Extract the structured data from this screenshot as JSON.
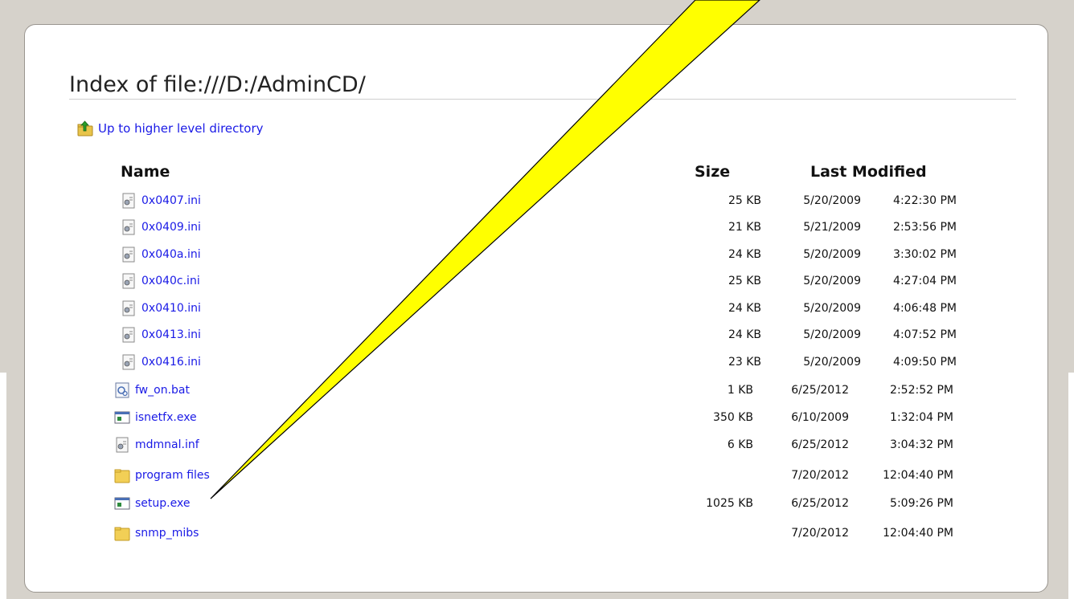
{
  "page": {
    "title": "Index of file:///D:/AdminCD/",
    "up_link": "Up to higher level directory"
  },
  "columns": {
    "name": "Name",
    "size": "Size",
    "modified": "Last Modified"
  },
  "files": [
    {
      "name": "0x0407.ini",
      "size": "25 KB",
      "date": "5/20/2009",
      "time": "4:22:30 PM",
      "icon": "ini-file-icon"
    },
    {
      "name": "0x0409.ini",
      "size": "21 KB",
      "date": "5/21/2009",
      "time": "2:53:56 PM",
      "icon": "ini-file-icon"
    },
    {
      "name": "0x040a.ini",
      "size": "24 KB",
      "date": "5/20/2009",
      "time": "3:30:02 PM",
      "icon": "ini-file-icon"
    },
    {
      "name": "0x040c.ini",
      "size": "25 KB",
      "date": "5/20/2009",
      "time": "4:27:04 PM",
      "icon": "ini-file-icon"
    },
    {
      "name": "0x0410.ini",
      "size": "24 KB",
      "date": "5/20/2009",
      "time": "4:06:48 PM",
      "icon": "ini-file-icon"
    },
    {
      "name": "0x0413.ini",
      "size": "24 KB",
      "date": "5/20/2009",
      "time": "4:07:52 PM",
      "icon": "ini-file-icon"
    },
    {
      "name": "0x0416.ini",
      "size": "23 KB",
      "date": "5/20/2009",
      "time": "4:09:50 PM",
      "icon": "ini-file-icon"
    },
    {
      "name": "fw_on.bat",
      "size": "1 KB",
      "date": "6/25/2012",
      "time": "2:52:52 PM",
      "icon": "batch-file-icon"
    },
    {
      "name": "isnetfx.exe",
      "size": "350 KB",
      "date": "6/10/2009",
      "time": "1:32:04 PM",
      "icon": "executable-icon"
    },
    {
      "name": "mdmnal.inf",
      "size": "6 KB",
      "date": "6/25/2012",
      "time": "3:04:32 PM",
      "icon": "ini-file-icon"
    },
    {
      "name": "program files",
      "size": "",
      "date": "7/20/2012",
      "time": "12:04:40 PM",
      "icon": "folder-icon"
    },
    {
      "name": "setup.exe",
      "size": "1025 KB",
      "date": "6/25/2012",
      "time": "5:09:26 PM",
      "icon": "executable-icon"
    },
    {
      "name": "snmp_mibs",
      "size": "",
      "date": "7/20/2012",
      "time": "12:04:40 PM",
      "icon": "folder-icon"
    }
  ],
  "colors": {
    "link": "#1a1ae6",
    "callout_fill": "#ffff00",
    "background": "#d6d2cb"
  }
}
